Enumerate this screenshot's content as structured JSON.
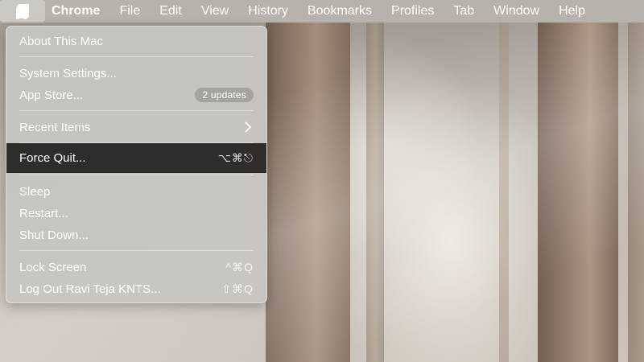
{
  "menubar": {
    "apple_icon": "apple-logo-icon",
    "app_name": "Chrome",
    "items": [
      "File",
      "Edit",
      "View",
      "History",
      "Bookmarks",
      "Profiles",
      "Tab",
      "Window",
      "Help"
    ]
  },
  "apple_menu": {
    "about": "About This Mac",
    "system_settings": "System Settings...",
    "app_store": "App Store...",
    "app_store_badge": "2 updates",
    "recent_items": "Recent Items",
    "recent_items_icon": "chevron-right-icon",
    "force_quit": "Force Quit...",
    "force_quit_shortcut": "⌥⌘⎋",
    "sleep": "Sleep",
    "restart": "Restart...",
    "shut_down": "Shut Down...",
    "lock_screen": "Lock Screen",
    "lock_screen_shortcut": "^⌘Q",
    "log_out": "Log Out Ravi Teja KNTS...",
    "log_out_shortcut": "⇧⌘Q"
  },
  "colors": {
    "menu_text": "#ffffff",
    "highlight": "#1e1c1a",
    "menu_background": "#c8c5c1"
  }
}
